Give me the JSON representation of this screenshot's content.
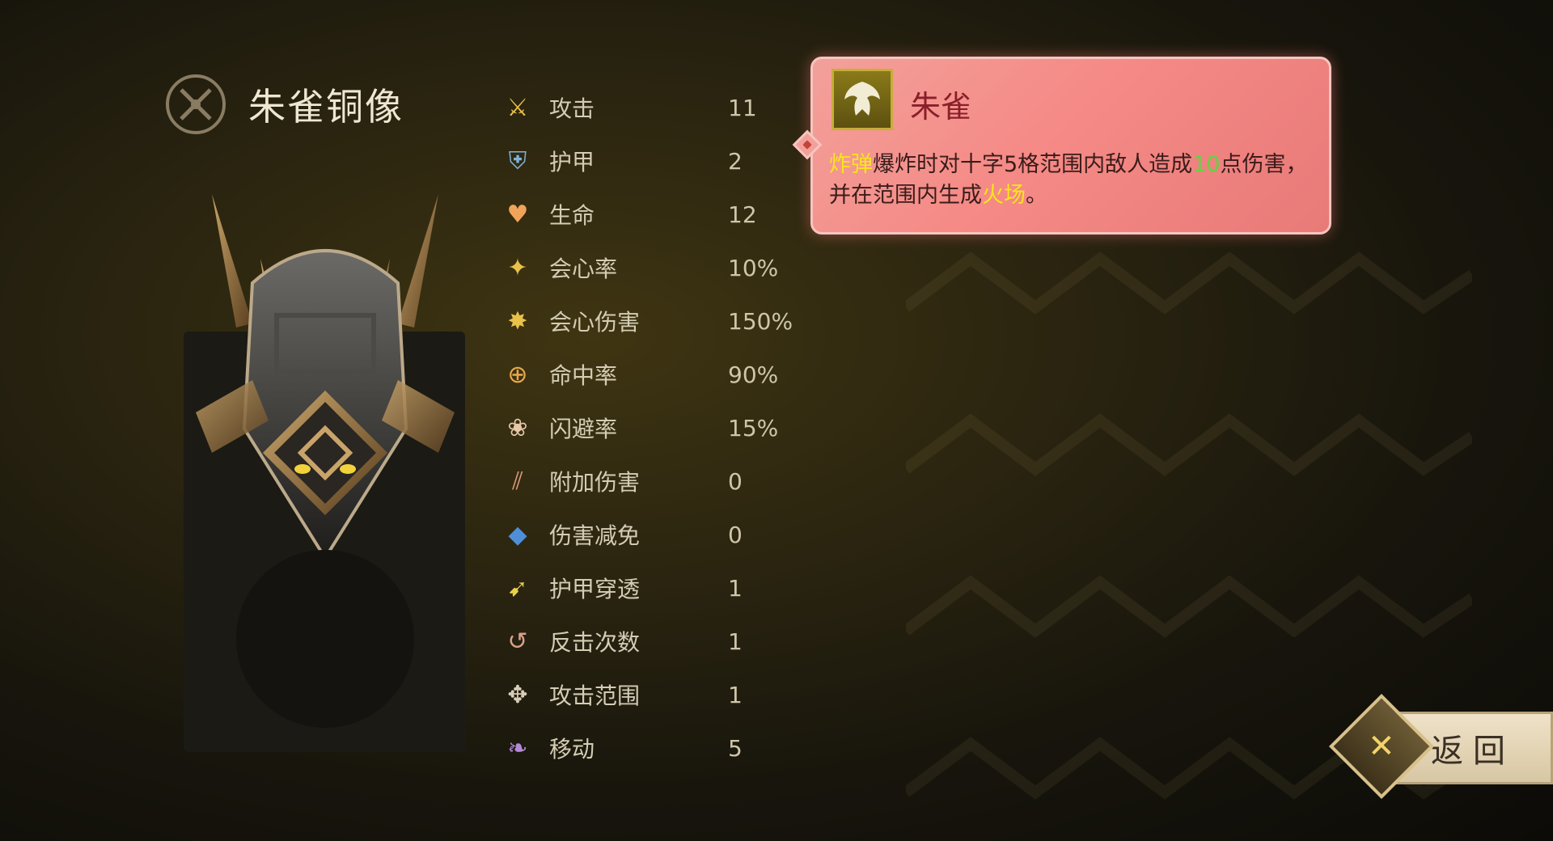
{
  "unit": {
    "name": "朱雀铜像",
    "icon": "crossed-swords-badge-icon"
  },
  "stats": [
    {
      "label": "攻击",
      "value": "11",
      "icon": "crossed-swords-icon",
      "color": "#e8c14a"
    },
    {
      "label": "护甲",
      "value": "2",
      "icon": "shield-icon",
      "color": "#7fb3d8"
    },
    {
      "label": "生命",
      "value": "12",
      "icon": "heart-icon",
      "color": "#f0a45a"
    },
    {
      "label": "会心率",
      "value": "10%",
      "icon": "star-icon",
      "color": "#e8c14a"
    },
    {
      "label": "会心伤害",
      "value": "150%",
      "icon": "crit-damage-icon",
      "color": "#e8c14a"
    },
    {
      "label": "命中率",
      "value": "90%",
      "icon": "target-icon",
      "color": "#e8a84a"
    },
    {
      "label": "闪避率",
      "value": "15%",
      "icon": "paw-icon",
      "color": "#e8c9a8"
    },
    {
      "label": "附加伤害",
      "value": "0",
      "icon": "slash-icon",
      "color": "#d89a7a"
    },
    {
      "label": "伤害减免",
      "value": "0",
      "icon": "blue-gem-icon",
      "color": "#4f8fd8"
    },
    {
      "label": "护甲穿透",
      "value": "1",
      "icon": "armor-pierce-icon",
      "color": "#e8d04a"
    },
    {
      "label": "反击次数",
      "value": "1",
      "icon": "counter-icon",
      "color": "#d8a08a"
    },
    {
      "label": "攻击范围",
      "value": "1",
      "icon": "range-arrows-icon",
      "color": "#d8cdb8"
    },
    {
      "label": "移动",
      "value": "5",
      "icon": "wing-icon",
      "color": "#b48ad8"
    }
  ],
  "tooltip": {
    "title": "朱雀",
    "icon": "phoenix-emblem-icon",
    "desc": {
      "p1": "炸弹",
      "p2": "爆炸时对十字5格范围内敌人造成",
      "p3": "10",
      "p4": "点伤害，并在范围内生成",
      "p5": "火场",
      "p6": "。"
    }
  },
  "back_button": {
    "label": "返回",
    "icon": "crossed-blades-icon"
  }
}
